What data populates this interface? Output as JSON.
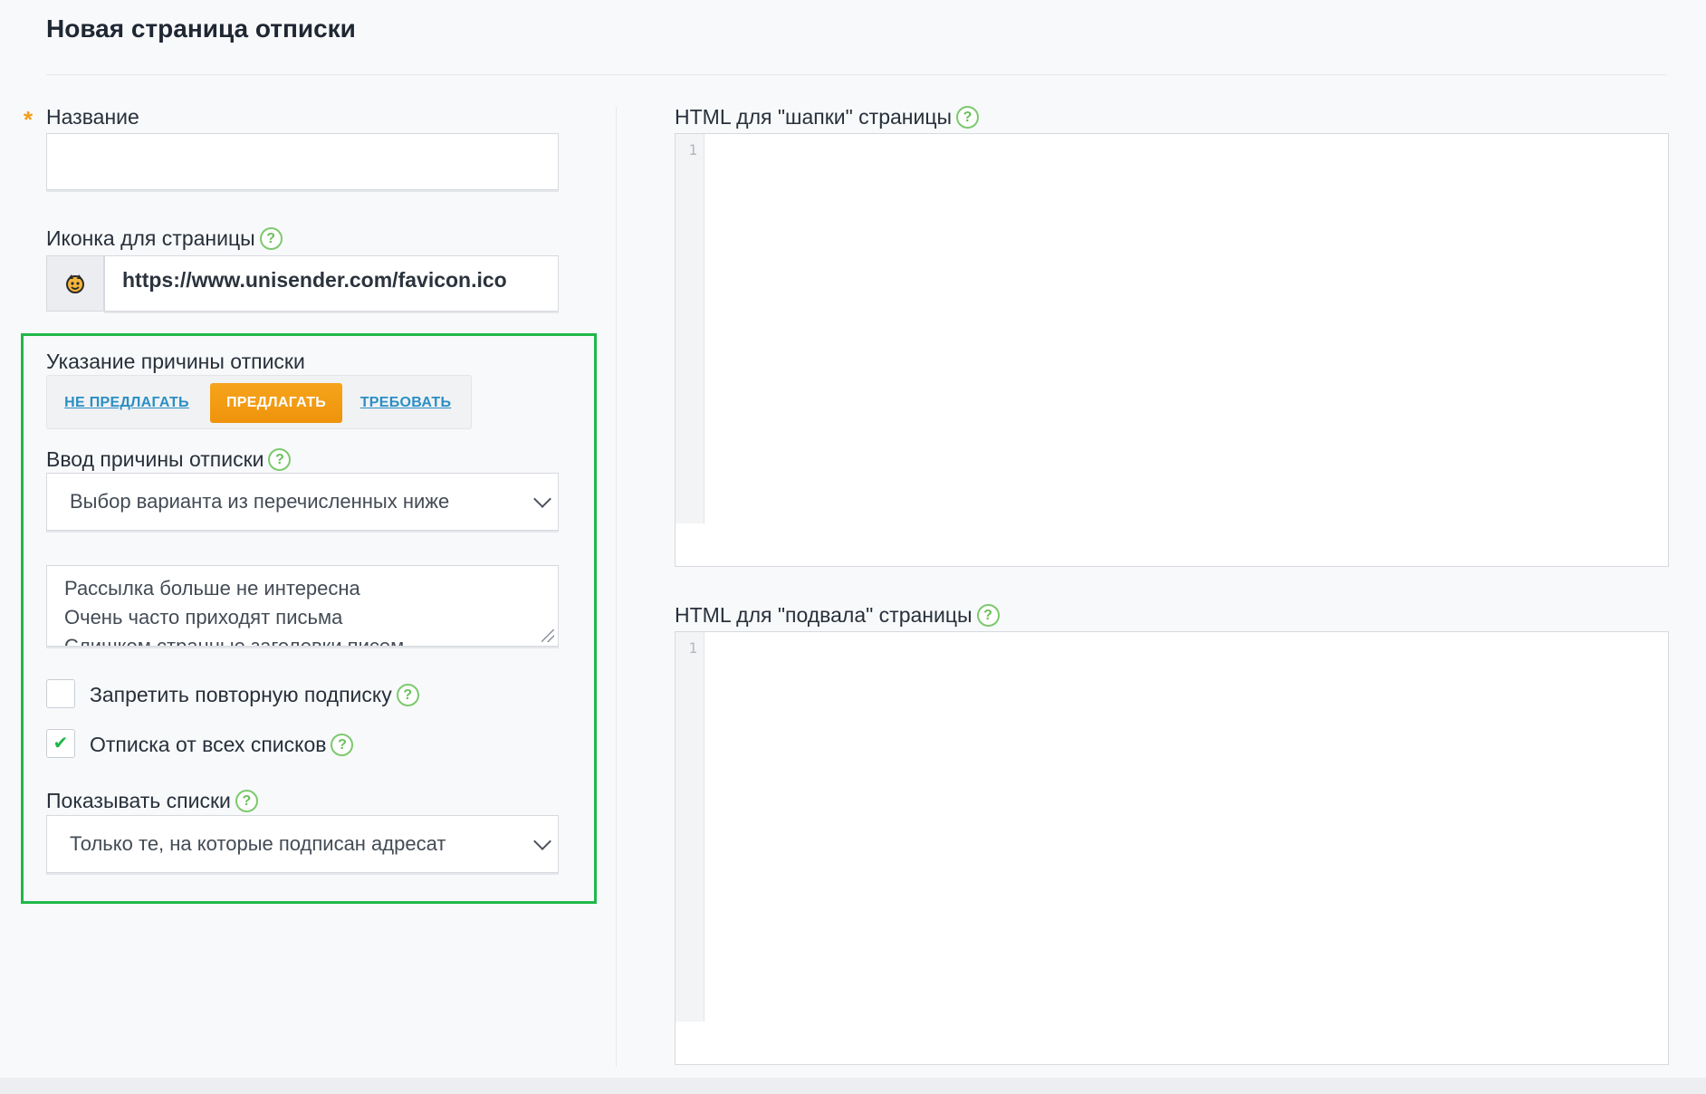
{
  "page": {
    "title": "Новая страница отписки"
  },
  "left": {
    "name_field": {
      "label": "Название",
      "required_mark": "*",
      "value": ""
    },
    "icon_field": {
      "label": "Иконка для страницы",
      "value": "https://www.unisender.com/favicon.ico",
      "preview_icon": "unisender-logo-icon"
    },
    "reason": {
      "label": "Указание причины отписки",
      "options": [
        "НЕ ПРЕДЛАГАТЬ",
        "ПРЕДЛАГАТЬ",
        "ТРЕБОВАТЬ"
      ],
      "selected": "ПРЕДЛАГАТЬ"
    },
    "reason_input": {
      "label": "Ввод причины отписки",
      "selected": "Выбор варианта из перечисленных ниже"
    },
    "reasons_text": {
      "lines": [
        "Рассылка больше не интересна",
        "Очень часто приходят письма",
        "Слишком странные заголовки писем"
      ]
    },
    "forbid_resubscribe": {
      "label": "Запретить повторную подписку",
      "checked": false
    },
    "unsubscribe_all": {
      "label": "Отписка от всех списков",
      "checked": true
    },
    "show_lists": {
      "label": "Показывать списки",
      "selected": "Только те, на которые подписан адресат"
    }
  },
  "right": {
    "header_html": {
      "label": "HTML для \"шапки\" страницы",
      "line_number": "1"
    },
    "footer_html": {
      "label": "HTML для \"подвала\" страницы",
      "line_number": "1"
    }
  },
  "colors": {
    "accent_orange": "#f39c12",
    "link_blue": "#2a8fc4",
    "help_green": "#6bbf5b",
    "highlight_frame": "#1fb84a"
  }
}
